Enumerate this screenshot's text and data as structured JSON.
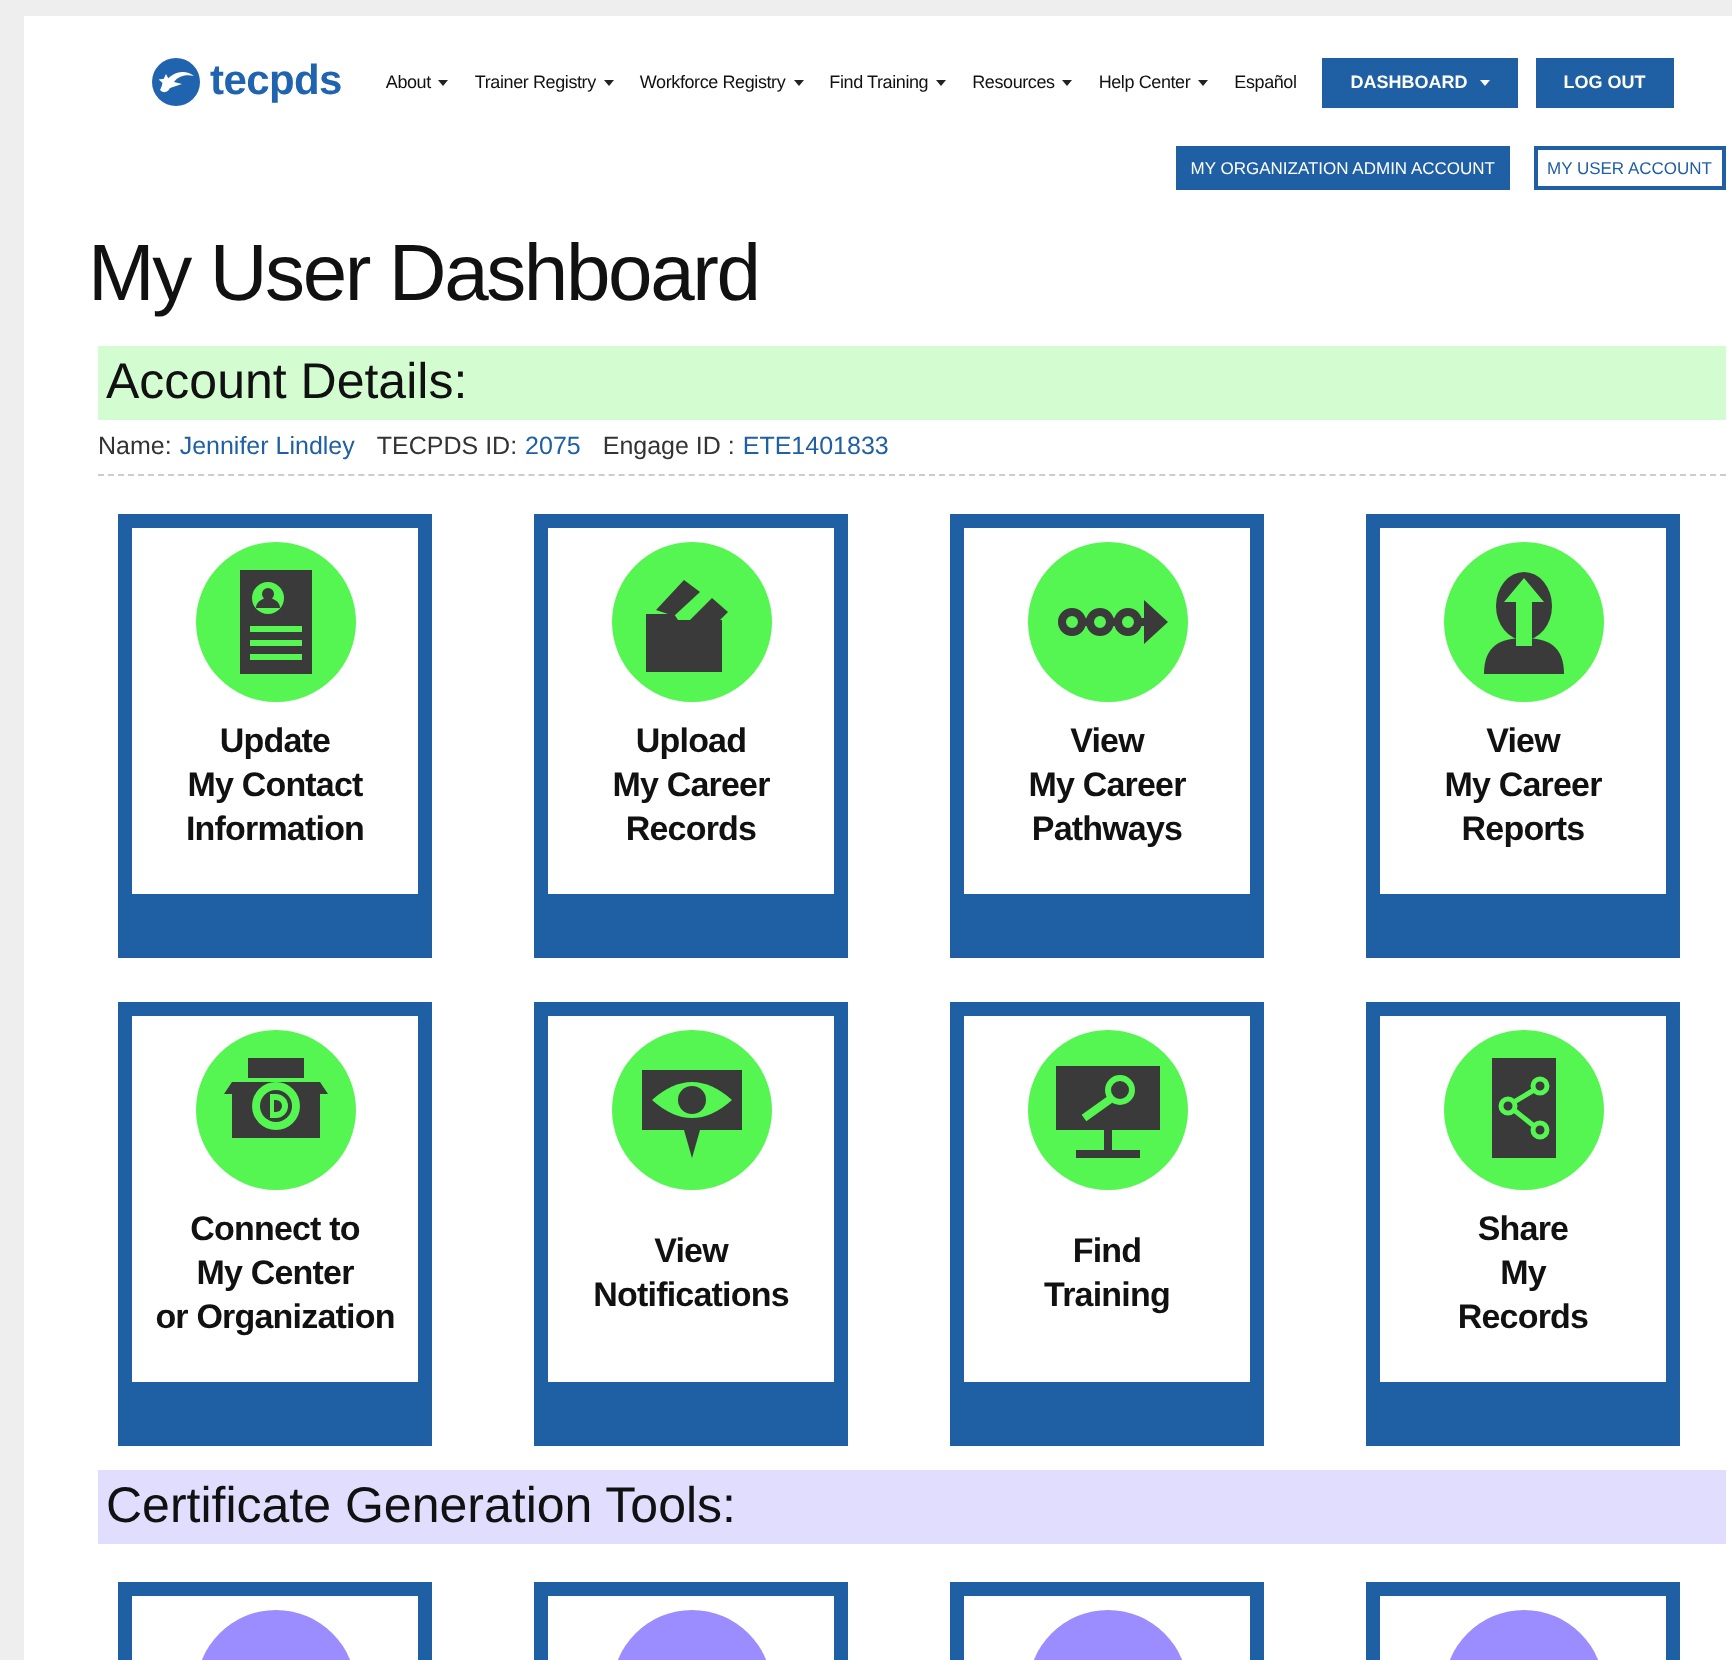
{
  "header": {
    "logo_text": "tecpds",
    "nav": [
      {
        "label": "About",
        "dropdown": true
      },
      {
        "label": "Trainer Registry",
        "dropdown": true
      },
      {
        "label": "Workforce Registry",
        "dropdown": true
      },
      {
        "label": "Find Training",
        "dropdown": true
      },
      {
        "label": "Resources",
        "dropdown": true
      },
      {
        "label": "Help Center",
        "dropdown": true
      },
      {
        "label": "Español",
        "dropdown": false
      }
    ],
    "buttons": [
      {
        "label": "DASHBOARD",
        "dropdown": true
      },
      {
        "label": "LOG OUT",
        "dropdown": false
      }
    ],
    "account_buttons": [
      {
        "label": "MY ORGANIZATION ADMIN ACCOUNT",
        "selected": false
      },
      {
        "label": "MY USER ACCOUNT",
        "selected": true
      }
    ]
  },
  "page_title": "My User Dashboard",
  "sections": [
    {
      "title": "Account Details:",
      "color": "#d3fdd1",
      "fields": [
        {
          "label": "Name:",
          "value": "Jennifer Lindley"
        },
        {
          "label": "TECPDS ID:",
          "value": "2075"
        },
        {
          "label": "Engage ID :",
          "value": "ETE1401833"
        }
      ],
      "tiles": [
        {
          "kind": "dashboard",
          "lines": [
            "Update",
            "My Contact",
            "Information"
          ]
        },
        {
          "kind": "dashboard",
          "lines": [
            "Upload",
            "My Career",
            "Records"
          ]
        },
        {
          "kind": "dashboard",
          "lines": [
            "View",
            "My Career",
            "Pathways"
          ]
        },
        {
          "kind": "dashboard",
          "lines": [
            "View",
            "My Career",
            "Reports"
          ]
        },
        {
          "kind": "dashboard",
          "lines": [
            "Connect to",
            "My Center",
            "or Organization"
          ]
        },
        {
          "kind": "dashboard",
          "lines": [
            "View",
            "Notifications"
          ]
        },
        {
          "kind": "dashboard",
          "lines": [
            "Find",
            "Training"
          ]
        },
        {
          "kind": "dashboard",
          "lines": [
            "Share",
            "My",
            "Records"
          ]
        }
      ]
    },
    {
      "title": "Certificate Generation Tools:",
      "color": "#e1ddfe",
      "tiles": [
        {
          "kind": "certificate"
        },
        {
          "kind": "certificate"
        },
        {
          "kind": "certificate"
        },
        {
          "kind": "certificate"
        }
      ]
    }
  ]
}
